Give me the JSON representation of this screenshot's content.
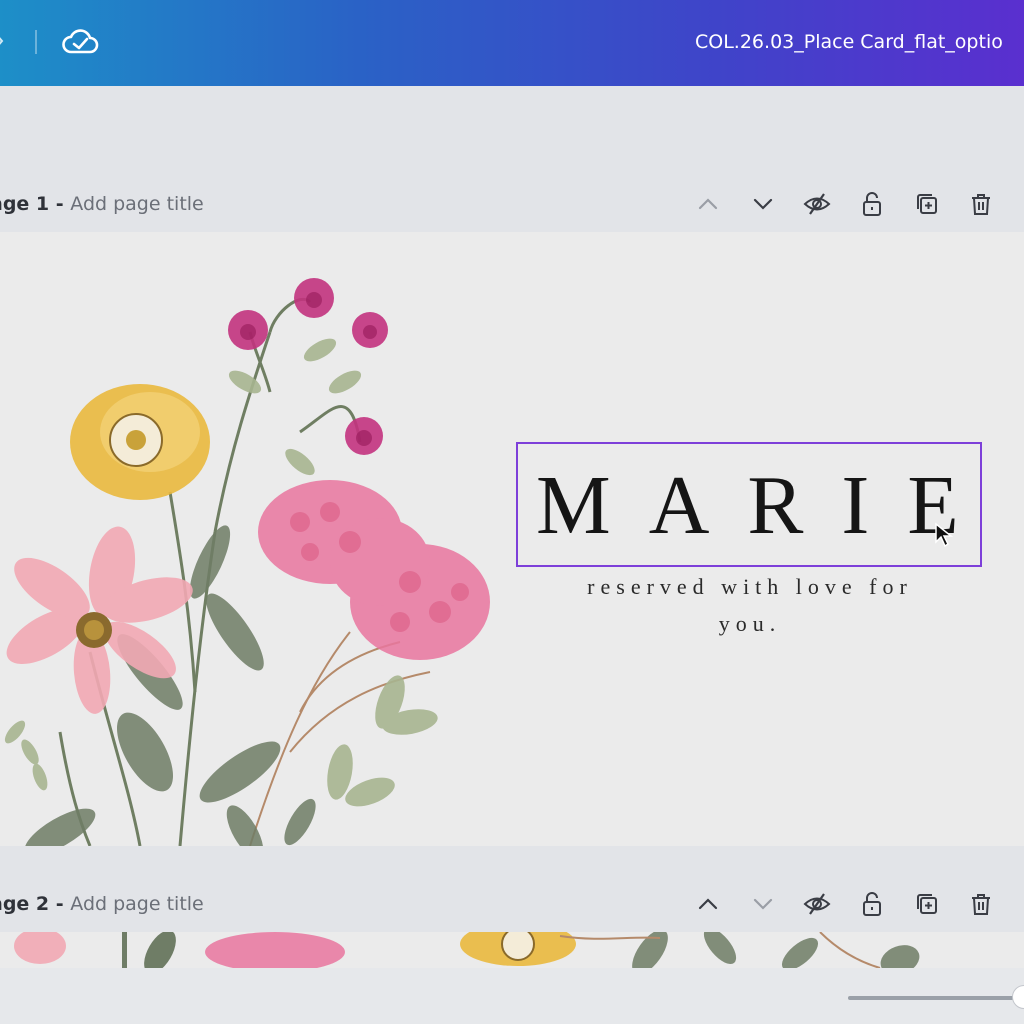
{
  "topbar": {
    "document_title": "COL.26.03_Place Card_flat_optio",
    "save_status_icon": "cloud-check-icon"
  },
  "pages": [
    {
      "prefix": "age 1",
      "separator": " - ",
      "title_placeholder": "Add page title",
      "tools": [
        "chevron-up-icon",
        "chevron-down-icon",
        "hide-icon",
        "unlock-icon",
        "duplicate-icon",
        "trash-icon"
      ]
    },
    {
      "prefix": "age 2",
      "separator": " - ",
      "title_placeholder": "Add page title",
      "tools": [
        "chevron-up-icon",
        "chevron-down-icon",
        "hide-icon",
        "unlock-icon",
        "duplicate-icon",
        "trash-icon"
      ]
    }
  ],
  "card": {
    "name": "MARIE",
    "subtitle_line1": "reserved with love for",
    "subtitle_line2": "you."
  },
  "colors": {
    "selection": "#7d3fd9",
    "canvas_bg": "#ebebeb"
  }
}
